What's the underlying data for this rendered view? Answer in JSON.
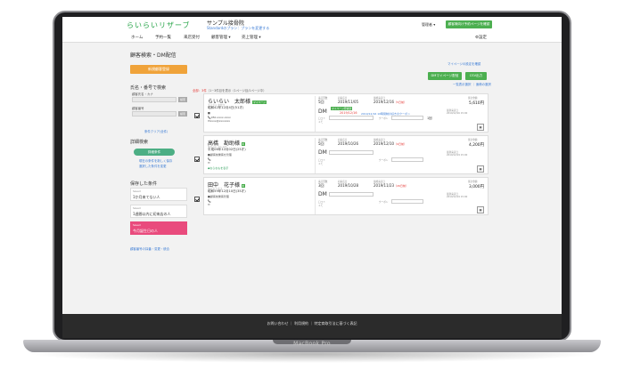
{
  "device": {
    "brand": "MacBook Pro"
  },
  "header": {
    "logo": "らいらいリザーブ",
    "shop_name": "サンプル接骨院",
    "plan_text": "Standardのプラン：プランを変更する",
    "admin_label": "管理者 ▾",
    "top_button": "顧客様向け予約ページを確認"
  },
  "nav": {
    "items": [
      "ホーム",
      "予約一覧",
      "来店受付",
      "顧客管理 ▾",
      "売上管理 ▾"
    ],
    "settings": "設定"
  },
  "page": {
    "title": "顧客検索・DM配信",
    "new_customer_button": "新規顧客登録"
  },
  "search": {
    "name_section": "氏名・番号で検索",
    "name_label": "顧客氏名・カナ",
    "number_label": "顧客番号",
    "search_button": "検索",
    "clear_link": "条件クリア(全件)",
    "detail_section": "詳細検索",
    "detail_button": "詳細条件",
    "detail_links": [
      "現在の条件を新しく保存",
      "選択した条件を変更"
    ]
  },
  "saved": {
    "section": "保存した条件",
    "items": [
      {
        "sub": "Saved",
        "label": "1か月来てない人",
        "active": false
      },
      {
        "sub": "Saved",
        "label": "1週間以内に初来店の人",
        "active": false
      },
      {
        "sub": "Saved",
        "label": "今月誕生日の人",
        "active": true
      }
    ],
    "bottom_link": "顧客番号の採番・変更・統合"
  },
  "results": {
    "mail_settings_link": "マイページの設定を確認",
    "dm_button": "DMマイページ配信",
    "csv_button": "CSV出力",
    "count_prefix": "全部：3件",
    "count_suffix": "（1~3件目を表示（1ページ目/1ページ中）",
    "sub_links": "一覧表示選択 ｜ 面積の選択",
    "labels": {
      "visits": "来店回数",
      "first": "初来店日",
      "last": "最終来店日",
      "total": "累計金額",
      "total_date": "最新来店日",
      "review": "口コミ",
      "memo": "メモ",
      "coupon": "クーポン"
    },
    "customers": [
      {
        "name": "らいらい　太郎様",
        "kana": "ライライ タロウ",
        "tag": "マイページ",
        "birth": "昭和42年12月4日(51才)",
        "lines": [
          "■",
          "📞050-xxxx-xxxx",
          "✉xxxx@xxxxxxx"
        ],
        "visits": "5回",
        "first": "2019/11/05",
        "last": "2019/12/16",
        "last_note": "（5日前）",
        "dm": "DM",
        "dm_badge": "マイページ登録済",
        "dm_date": "2019/12/16",
        "dm_link": "2019/12/16 10時間制の好きのクーポン",
        "right_count": "1回",
        "amount": "5,610円",
        "amount_date": "2019/12/16 15:00"
      },
      {
        "name": "高橋　勘助様",
        "kana": "タカハシ カンスケ",
        "tag": "",
        "birth": "平成06年12月02日(25才)",
        "lines": [
          "■顧客前乗客を管理",
          "📞",
          "✉"
        ],
        "extra": "◆ならなもを表示",
        "visits": "5回",
        "first": "2019/10/26",
        "last": "2019/12/10",
        "last_note": "（9日前）",
        "dm": "DM",
        "dm_badge": "",
        "dm_date": "",
        "dm_link": "",
        "right_count": "",
        "amount": "4,200円",
        "amount_date": "2019/12/19 15:00"
      },
      {
        "name": "田中　花子様",
        "kana": "タナカ ハナコ",
        "tag": "",
        "birth": "昭和59年12月10日(35才)",
        "lines": [
          "■顧客前乗客管理",
          "📞",
          "✉"
        ],
        "visits": "3回",
        "first": "2019/10/28",
        "last": "2019/11/23",
        "last_note": "（26日前）",
        "dm": "DM",
        "dm_badge": "",
        "dm_date": "",
        "dm_link": "",
        "right_count": "",
        "amount": "3,000円",
        "amount_date": "2019/12/19 15:00"
      }
    ]
  },
  "footer": {
    "text": "お問い合わせ ｜ 利用規約 ｜ 特定商取引法に基づく表記"
  }
}
